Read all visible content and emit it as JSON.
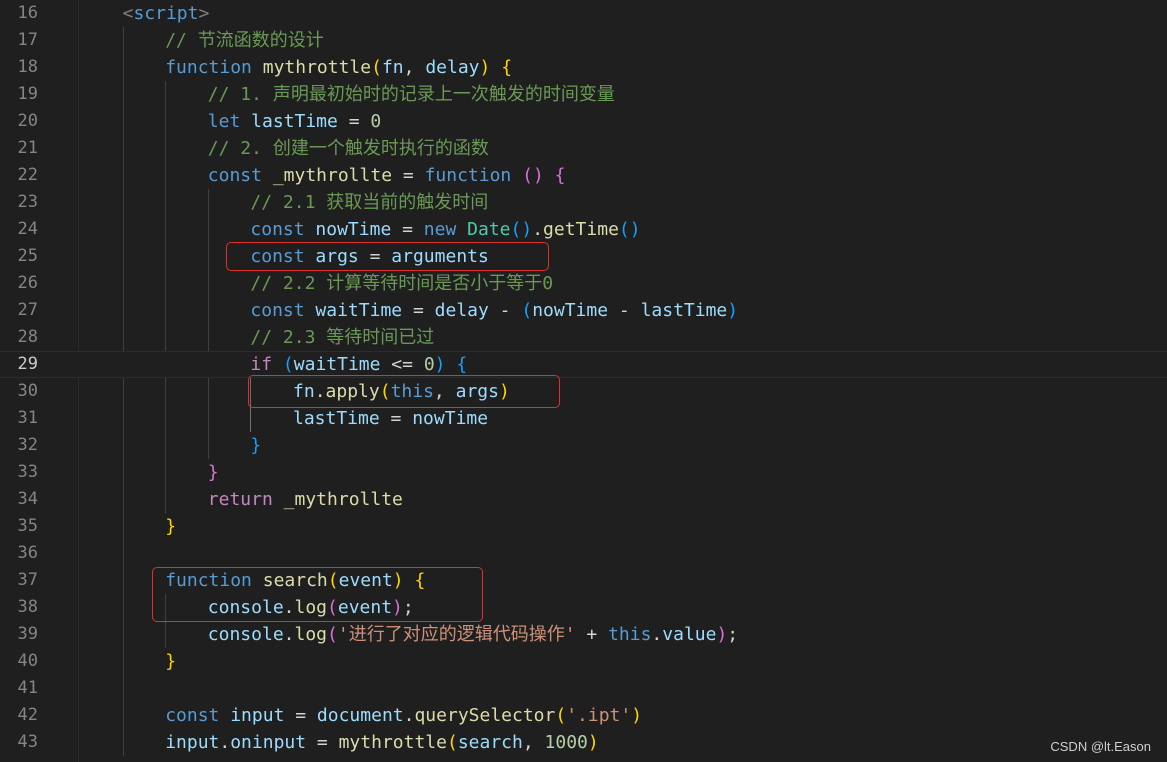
{
  "editor": {
    "colors": {
      "background": "#1f1f1f",
      "line_number": "#858585",
      "keyword": "#569cd6",
      "control": "#c586c0",
      "function": "#dcdcaa",
      "variable": "#9cdcfe",
      "class": "#4ec9b0",
      "number": "#b5cea8",
      "string": "#ce9178",
      "comment": "#6a9955",
      "tag": "#808080",
      "bracket_gold": "#ffd700",
      "bracket_pink": "#da70d6",
      "bracket_blue": "#179fff",
      "highlight_box": "#e0302a"
    },
    "current_line": "29",
    "lines": [
      {
        "num": "16",
        "indent": 1,
        "tokens": [
          [
            "<",
            "tag"
          ],
          [
            "script",
            "keyword"
          ],
          [
            ">",
            "tag"
          ]
        ]
      },
      {
        "num": "17",
        "indent": 2,
        "tokens": [
          [
            "// 节流函数的设计",
            "comment"
          ]
        ]
      },
      {
        "num": "18",
        "indent": 2,
        "tokens": [
          [
            "function",
            "keyword"
          ],
          [
            " ",
            "plain"
          ],
          [
            "mythrottle",
            "function"
          ],
          [
            "(",
            "gold"
          ],
          [
            "fn",
            "variable"
          ],
          [
            ", ",
            "plain"
          ],
          [
            "delay",
            "variable"
          ],
          [
            ")",
            "gold"
          ],
          [
            " ",
            "plain"
          ],
          [
            "{",
            "gold"
          ]
        ]
      },
      {
        "num": "19",
        "indent": 3,
        "tokens": [
          [
            "// 1. 声明最初始时的记录上一次触发的时间变量",
            "comment"
          ]
        ]
      },
      {
        "num": "20",
        "indent": 3,
        "tokens": [
          [
            "let",
            "keyword"
          ],
          [
            " ",
            "plain"
          ],
          [
            "lastTime",
            "variable"
          ],
          [
            " = ",
            "plain"
          ],
          [
            "0",
            "number"
          ]
        ]
      },
      {
        "num": "21",
        "indent": 3,
        "tokens": [
          [
            "// 2. 创建一个触发时执行的函数",
            "comment"
          ]
        ]
      },
      {
        "num": "22",
        "indent": 3,
        "tokens": [
          [
            "const",
            "keyword"
          ],
          [
            " ",
            "plain"
          ],
          [
            "_mythrollte",
            "function"
          ],
          [
            " = ",
            "plain"
          ],
          [
            "function",
            "keyword"
          ],
          [
            " ",
            "plain"
          ],
          [
            "()",
            "pink"
          ],
          [
            " ",
            "plain"
          ],
          [
            "{",
            "pink"
          ]
        ]
      },
      {
        "num": "23",
        "indent": 4,
        "tokens": [
          [
            "// 2.1 获取当前的触发时间",
            "comment"
          ]
        ]
      },
      {
        "num": "24",
        "indent": 4,
        "tokens": [
          [
            "const",
            "keyword"
          ],
          [
            " ",
            "plain"
          ],
          [
            "nowTime",
            "variable"
          ],
          [
            " = ",
            "plain"
          ],
          [
            "new",
            "keyword"
          ],
          [
            " ",
            "plain"
          ],
          [
            "Date",
            "class"
          ],
          [
            "()",
            "blue"
          ],
          [
            ".",
            "plain"
          ],
          [
            "getTime",
            "function"
          ],
          [
            "()",
            "blue"
          ]
        ]
      },
      {
        "num": "25",
        "indent": 4,
        "tokens": [
          [
            "const",
            "keyword"
          ],
          [
            " ",
            "plain"
          ],
          [
            "args",
            "variable"
          ],
          [
            " = ",
            "plain"
          ],
          [
            "arguments",
            "variable"
          ]
        ]
      },
      {
        "num": "26",
        "indent": 4,
        "tokens": [
          [
            "// 2.2 计算等待时间是否小于等于0",
            "comment"
          ]
        ]
      },
      {
        "num": "27",
        "indent": 4,
        "tokens": [
          [
            "const",
            "keyword"
          ],
          [
            " ",
            "plain"
          ],
          [
            "waitTime",
            "variable"
          ],
          [
            " = ",
            "plain"
          ],
          [
            "delay",
            "variable"
          ],
          [
            " - ",
            "plain"
          ],
          [
            "(",
            "blue"
          ],
          [
            "nowTime",
            "variable"
          ],
          [
            " - ",
            "plain"
          ],
          [
            "lastTime",
            "variable"
          ],
          [
            ")",
            "blue"
          ]
        ]
      },
      {
        "num": "28",
        "indent": 4,
        "tokens": [
          [
            "// 2.3 等待时间已过",
            "comment"
          ]
        ]
      },
      {
        "num": "29",
        "indent": 4,
        "tokens": [
          [
            "if",
            "control"
          ],
          [
            " ",
            "plain"
          ],
          [
            "(",
            "blue"
          ],
          [
            "waitTime",
            "variable"
          ],
          [
            " <= ",
            "plain"
          ],
          [
            "0",
            "number"
          ],
          [
            ")",
            "blue"
          ],
          [
            " ",
            "plain"
          ],
          [
            "{",
            "blue"
          ]
        ]
      },
      {
        "num": "30",
        "indent": 5,
        "tokens": [
          [
            "fn",
            "variable"
          ],
          [
            ".",
            "plain"
          ],
          [
            "apply",
            "function"
          ],
          [
            "(",
            "gold"
          ],
          [
            "this",
            "keyword"
          ],
          [
            ", ",
            "plain"
          ],
          [
            "args",
            "variable"
          ],
          [
            ")",
            "gold"
          ]
        ]
      },
      {
        "num": "31",
        "indent": 5,
        "tokens": [
          [
            "lastTime",
            "variable"
          ],
          [
            " = ",
            "plain"
          ],
          [
            "nowTime",
            "variable"
          ]
        ]
      },
      {
        "num": "32",
        "indent": 4,
        "tokens": [
          [
            "}",
            "blue"
          ]
        ]
      },
      {
        "num": "33",
        "indent": 3,
        "tokens": [
          [
            "}",
            "pink"
          ]
        ]
      },
      {
        "num": "34",
        "indent": 3,
        "tokens": [
          [
            "return",
            "control"
          ],
          [
            " ",
            "plain"
          ],
          [
            "_mythrollte",
            "function"
          ]
        ]
      },
      {
        "num": "35",
        "indent": 2,
        "tokens": [
          [
            "}",
            "gold"
          ]
        ]
      },
      {
        "num": "36",
        "indent": 0,
        "tokens": []
      },
      {
        "num": "37",
        "indent": 2,
        "tokens": [
          [
            "function",
            "keyword"
          ],
          [
            " ",
            "plain"
          ],
          [
            "search",
            "function"
          ],
          [
            "(",
            "gold"
          ],
          [
            "event",
            "variable"
          ],
          [
            ")",
            "gold"
          ],
          [
            " ",
            "plain"
          ],
          [
            "{",
            "gold"
          ]
        ]
      },
      {
        "num": "38",
        "indent": 3,
        "tokens": [
          [
            "console",
            "variable"
          ],
          [
            ".",
            "plain"
          ],
          [
            "log",
            "function"
          ],
          [
            "(",
            "pink"
          ],
          [
            "event",
            "variable"
          ],
          [
            ")",
            "pink"
          ],
          [
            ";",
            "plain"
          ]
        ]
      },
      {
        "num": "39",
        "indent": 3,
        "tokens": [
          [
            "console",
            "variable"
          ],
          [
            ".",
            "plain"
          ],
          [
            "log",
            "function"
          ],
          [
            "(",
            "pink"
          ],
          [
            "'进行了对应的逻辑代码操作'",
            "string"
          ],
          [
            " + ",
            "plain"
          ],
          [
            "this",
            "keyword"
          ],
          [
            ".",
            "plain"
          ],
          [
            "value",
            "variable"
          ],
          [
            ")",
            "pink"
          ],
          [
            ";",
            "plain"
          ]
        ]
      },
      {
        "num": "40",
        "indent": 2,
        "tokens": [
          [
            "}",
            "gold"
          ]
        ]
      },
      {
        "num": "41",
        "indent": 0,
        "tokens": []
      },
      {
        "num": "42",
        "indent": 2,
        "tokens": [
          [
            "const",
            "keyword"
          ],
          [
            " ",
            "plain"
          ],
          [
            "input",
            "variable"
          ],
          [
            " = ",
            "plain"
          ],
          [
            "document",
            "variable"
          ],
          [
            ".",
            "plain"
          ],
          [
            "querySelector",
            "function"
          ],
          [
            "(",
            "gold"
          ],
          [
            "'.ipt'",
            "string"
          ],
          [
            ")",
            "gold"
          ]
        ]
      },
      {
        "num": "43",
        "indent": 2,
        "tokens": [
          [
            "input",
            "variable"
          ],
          [
            ".",
            "plain"
          ],
          [
            "oninput",
            "variable"
          ],
          [
            " = ",
            "plain"
          ],
          [
            "mythrottle",
            "function"
          ],
          [
            "(",
            "gold"
          ],
          [
            "search",
            "variable"
          ],
          [
            ", ",
            "plain"
          ],
          [
            "1000",
            "number"
          ],
          [
            ")",
            "gold"
          ]
        ]
      }
    ]
  },
  "watermark": "CSDN @lt.Eason"
}
